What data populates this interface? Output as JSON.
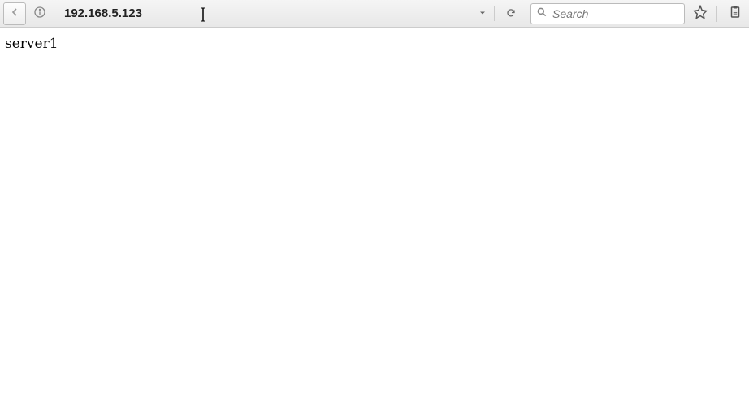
{
  "toolbar": {
    "url": "192.168.5.123",
    "search_placeholder": "Search"
  },
  "page": {
    "body_text": "server1"
  }
}
